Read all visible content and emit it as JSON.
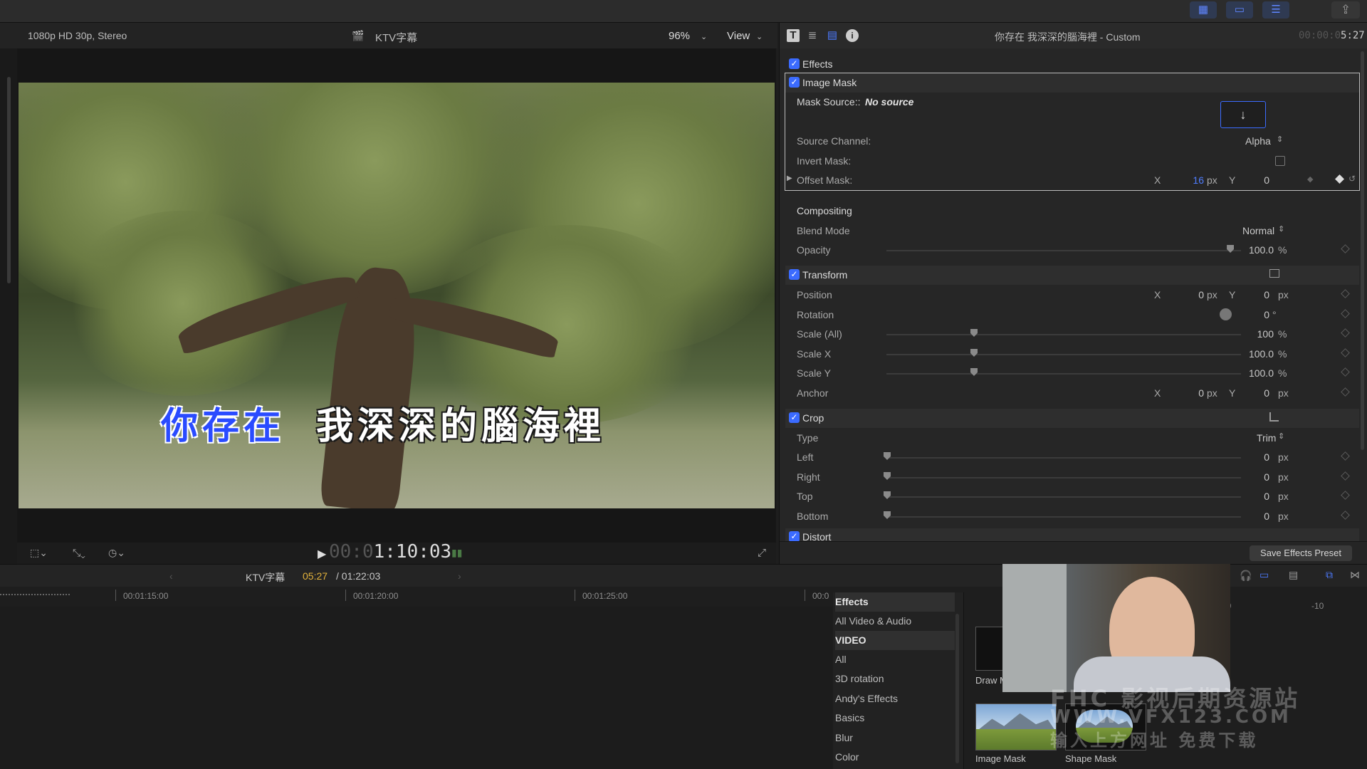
{
  "viewer": {
    "format": "1080p HD 30p, Stereo",
    "project_name": "KTV字幕",
    "zoom": "96%",
    "view_label": "View",
    "subtitle_blue": "你存在",
    "subtitle_white": "我深深的腦海裡",
    "timecode_dim": "00:0",
    "timecode": "1:10:03"
  },
  "inspector": {
    "clip_title": "你存在  我深深的腦海裡 - Custom",
    "duration_dim": "00:00:0",
    "duration": "5:27",
    "effects_label": "Effects",
    "image_mask": {
      "title": "Image Mask",
      "mask_source_label": "Mask Source::",
      "mask_source_value": "No source",
      "source_channel_label": "Source Channel:",
      "source_channel_value": "Alpha",
      "invert_mask_label": "Invert Mask:",
      "offset_mask_label": "Offset Mask:",
      "offset_x": "16",
      "offset_y": "0"
    },
    "compositing": {
      "title": "Compositing",
      "blend_mode_label": "Blend Mode",
      "blend_mode_value": "Normal",
      "opacity_label": "Opacity",
      "opacity_value": "100.0",
      "opacity_level": 1.0
    },
    "transform": {
      "title": "Transform",
      "position_label": "Position",
      "position_x": "0",
      "position_y": "0",
      "rotation_label": "Rotation",
      "rotation_value": "0",
      "scale_all_label": "Scale (All)",
      "scale_all_value": "100",
      "scale_x_label": "Scale X",
      "scale_x_value": "100.0",
      "scale_y_label": "Scale Y",
      "scale_y_value": "100.0",
      "anchor_label": "Anchor",
      "anchor_x": "0",
      "anchor_y": "0"
    },
    "crop": {
      "title": "Crop",
      "type_label": "Type",
      "type_value": "Trim",
      "left_label": "Left",
      "left_value": "0",
      "right_label": "Right",
      "right_value": "0",
      "top_label": "Top",
      "top_value": "0",
      "bottom_label": "Bottom",
      "bottom_value": "0"
    },
    "distort_label": "Distort",
    "save_preset": "Save Effects Preset",
    "units": {
      "px": "px",
      "pct": "%",
      "deg": "°",
      "x": "X",
      "y": "Y"
    }
  },
  "timeline": {
    "project_name": "KTV字幕",
    "position": "05:27",
    "duration": "/ 01:22:03",
    "ticks": [
      "00:01:15:00",
      "00:01:20:00",
      "00:01:25:00",
      "00:0"
    ],
    "right_ticks": [
      "30",
      "-10"
    ]
  },
  "effects_browser": {
    "categories": [
      "Effects",
      "All Video & Audio",
      "VIDEO",
      "All",
      "3D rotation",
      "Andy's Effects",
      "Basics",
      "Blur",
      "Color"
    ],
    "items": [
      {
        "label": "Draw M"
      },
      {
        "label": "Image Mask"
      },
      {
        "label": "Shape Mask"
      }
    ]
  },
  "watermark": {
    "line1": "FHC 影视后期资源站",
    "line2": "WWW.VFX123.COM",
    "line3": "输入上方网址 免费下载"
  }
}
